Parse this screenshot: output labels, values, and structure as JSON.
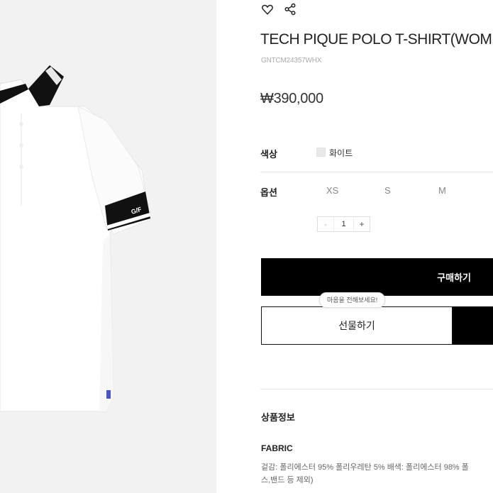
{
  "product": {
    "title": "TECH PIQUE POLO T-SHIRT(WOMEN)",
    "code": "GNTCM24357WHX",
    "price": "₩390,000",
    "sleeve_logo_text": "G/F"
  },
  "options": {
    "color_label": "색상",
    "color_value": "화이트",
    "size_label": "옵션",
    "sizes": [
      "XS",
      "S",
      "M"
    ],
    "quantity": "1",
    "minus": "-",
    "plus": "+"
  },
  "actions": {
    "buy_label": "구매하기",
    "gift_tooltip": "마음을 전해보세요!",
    "gift_label": "선물하기"
  },
  "details": {
    "section_title": "상품정보",
    "fabric_title": "FABRIC",
    "fabric_line1": "겉감: 폴리에스터 95% 폴리우레탄 5% 배색: 폴리에스터 98% 폴",
    "fabric_line2": "스,밴드 등 제외)"
  },
  "colors": {
    "background_image": "#f2f2f2",
    "button_black": "#000000",
    "shirt": "#ffffff",
    "trim": "#111111"
  },
  "icons": [
    "heart-icon",
    "share-icon"
  ]
}
